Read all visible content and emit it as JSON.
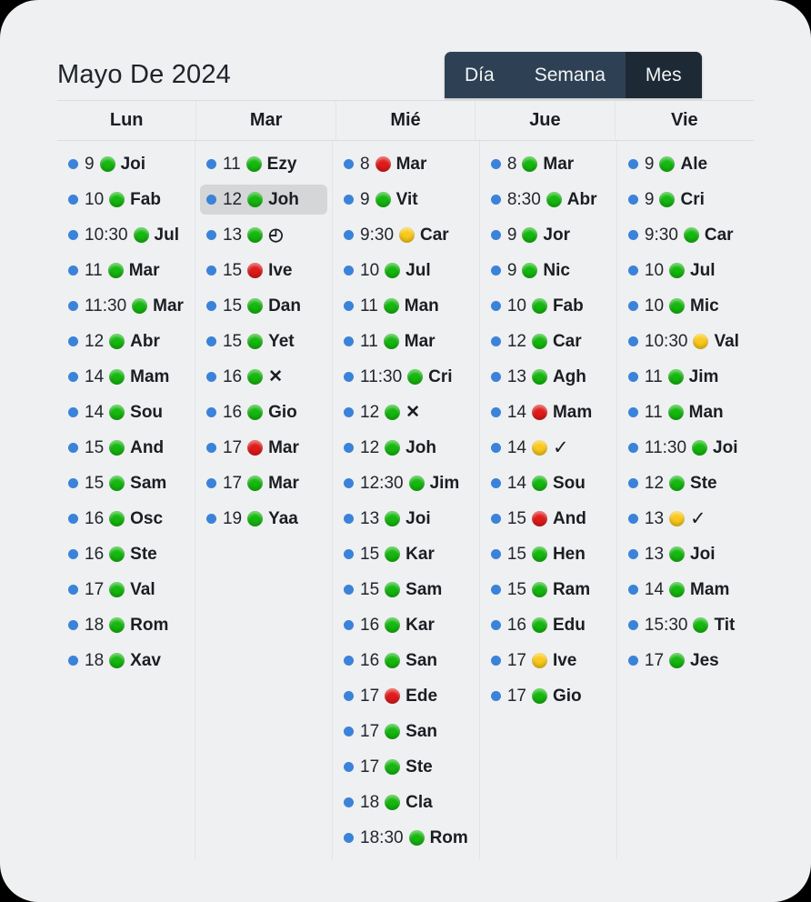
{
  "header": {
    "title": "Mayo De 2024",
    "view_switch": {
      "options": [
        {
          "label": "Día",
          "selected": false
        },
        {
          "label": "Semana",
          "selected": false
        },
        {
          "label": "Mes",
          "selected": true
        }
      ]
    }
  },
  "colors": {
    "card_background": "#eff0f2",
    "page_background": "#000000",
    "switch_bar": "#2e4154",
    "switch_active": "#1d2935",
    "bullet_blue": "#3b82d9",
    "status_green": "#15b80f",
    "status_red": "#e01b1b",
    "status_yellow": "#fbc91b",
    "selected_row": "#d5d6d8",
    "grid_line": "#e2e4e7"
  },
  "calendar": {
    "columns": [
      {
        "header": "Lun",
        "events": [
          {
            "time": "9",
            "status": "green",
            "name": "Joi",
            "selected": false
          },
          {
            "time": "10",
            "status": "green",
            "name": "Fab",
            "selected": false
          },
          {
            "time": "10:30",
            "status": "green",
            "name": "Jul",
            "selected": false
          },
          {
            "time": "11",
            "status": "green",
            "name": "Mar",
            "selected": false
          },
          {
            "time": "11:30",
            "status": "green",
            "name": "Mar",
            "selected": false
          },
          {
            "time": "12",
            "status": "green",
            "name": "Abr",
            "selected": false
          },
          {
            "time": "14",
            "status": "green",
            "name": "Mam",
            "selected": false
          },
          {
            "time": "14",
            "status": "green",
            "name": "Sou",
            "selected": false
          },
          {
            "time": "15",
            "status": "green",
            "name": "And",
            "selected": false
          },
          {
            "time": "15",
            "status": "green",
            "name": "Sam",
            "selected": false
          },
          {
            "time": "16",
            "status": "green",
            "name": "Osc",
            "selected": false
          },
          {
            "time": "16",
            "status": "green",
            "name": "Ste",
            "selected": false
          },
          {
            "time": "17",
            "status": "green",
            "name": "Val",
            "selected": false
          },
          {
            "time": "18",
            "status": "green",
            "name": "Rom",
            "selected": false
          },
          {
            "time": "18",
            "status": "green",
            "name": "Xav",
            "selected": false
          }
        ]
      },
      {
        "header": "Mar",
        "events": [
          {
            "time": "11",
            "status": "green",
            "name": "Ezy",
            "selected": false
          },
          {
            "time": "12",
            "status": "green",
            "name": "Joh",
            "selected": true
          },
          {
            "time": "13",
            "status": "green",
            "name": "◴",
            "glyph": "clock",
            "selected": false
          },
          {
            "time": "15",
            "status": "red",
            "name": "Ive",
            "selected": false
          },
          {
            "time": "15",
            "status": "green",
            "name": "Dan",
            "selected": false
          },
          {
            "time": "15",
            "status": "green",
            "name": "Yet",
            "selected": false
          },
          {
            "time": "16",
            "status": "green",
            "name": "✕",
            "glyph": "cross",
            "selected": false
          },
          {
            "time": "16",
            "status": "green",
            "name": "Gio",
            "selected": false
          },
          {
            "time": "17",
            "status": "red",
            "name": "Mar",
            "selected": false
          },
          {
            "time": "17",
            "status": "green",
            "name": "Mar",
            "selected": false
          },
          {
            "time": "19",
            "status": "green",
            "name": "Yaa",
            "selected": false
          }
        ]
      },
      {
        "header": "Mié",
        "events": [
          {
            "time": "8",
            "status": "red",
            "name": "Mar",
            "selected": false
          },
          {
            "time": "9",
            "status": "green",
            "name": "Vit",
            "selected": false
          },
          {
            "time": "9:30",
            "status": "yellow",
            "name": "Car",
            "selected": false
          },
          {
            "time": "10",
            "status": "green",
            "name": "Jul",
            "selected": false
          },
          {
            "time": "11",
            "status": "green",
            "name": "Man",
            "selected": false
          },
          {
            "time": "11",
            "status": "green",
            "name": "Mar",
            "selected": false
          },
          {
            "time": "11:30",
            "status": "green",
            "name": "Cri",
            "selected": false
          },
          {
            "time": "12",
            "status": "green",
            "name": "✕",
            "glyph": "cross",
            "selected": false
          },
          {
            "time": "12",
            "status": "green",
            "name": "Joh",
            "selected": false
          },
          {
            "time": "12:30",
            "status": "green",
            "name": "Jim",
            "selected": false
          },
          {
            "time": "13",
            "status": "green",
            "name": "Joi",
            "selected": false
          },
          {
            "time": "15",
            "status": "green",
            "name": "Kar",
            "selected": false
          },
          {
            "time": "15",
            "status": "green",
            "name": "Sam",
            "selected": false
          },
          {
            "time": "16",
            "status": "green",
            "name": "Kar",
            "selected": false
          },
          {
            "time": "16",
            "status": "green",
            "name": "San",
            "selected": false
          },
          {
            "time": "17",
            "status": "red",
            "name": "Ede",
            "selected": false
          },
          {
            "time": "17",
            "status": "green",
            "name": "San",
            "selected": false
          },
          {
            "time": "17",
            "status": "green",
            "name": "Ste",
            "selected": false
          },
          {
            "time": "18",
            "status": "green",
            "name": "Cla",
            "selected": false
          },
          {
            "time": "18:30",
            "status": "green",
            "name": "Rom",
            "selected": false
          }
        ]
      },
      {
        "header": "Jue",
        "events": [
          {
            "time": "8",
            "status": "green",
            "name": "Mar",
            "selected": false
          },
          {
            "time": "8:30",
            "status": "green",
            "name": "Abr",
            "selected": false
          },
          {
            "time": "9",
            "status": "green",
            "name": "Jor",
            "selected": false
          },
          {
            "time": "9",
            "status": "green",
            "name": "Nic",
            "selected": false
          },
          {
            "time": "10",
            "status": "green",
            "name": "Fab",
            "selected": false
          },
          {
            "time": "12",
            "status": "green",
            "name": "Car",
            "selected": false
          },
          {
            "time": "13",
            "status": "green",
            "name": "Agh",
            "selected": false
          },
          {
            "time": "14",
            "status": "red",
            "name": "Mam",
            "selected": false
          },
          {
            "time": "14",
            "status": "yellow",
            "name": "✓",
            "glyph": "check",
            "selected": false
          },
          {
            "time": "14",
            "status": "green",
            "name": "Sou",
            "selected": false
          },
          {
            "time": "15",
            "status": "red",
            "name": "And",
            "selected": false
          },
          {
            "time": "15",
            "status": "green",
            "name": "Hen",
            "selected": false
          },
          {
            "time": "15",
            "status": "green",
            "name": "Ram",
            "selected": false
          },
          {
            "time": "16",
            "status": "green",
            "name": "Edu",
            "selected": false
          },
          {
            "time": "17",
            "status": "yellow",
            "name": "Ive",
            "selected": false
          },
          {
            "time": "17",
            "status": "green",
            "name": "Gio",
            "selected": false
          }
        ]
      },
      {
        "header": "Vie",
        "events": [
          {
            "time": "9",
            "status": "green",
            "name": "Ale",
            "selected": false
          },
          {
            "time": "9",
            "status": "green",
            "name": "Cri",
            "selected": false
          },
          {
            "time": "9:30",
            "status": "green",
            "name": "Car",
            "selected": false
          },
          {
            "time": "10",
            "status": "green",
            "name": "Jul",
            "selected": false
          },
          {
            "time": "10",
            "status": "green",
            "name": "Mic",
            "selected": false
          },
          {
            "time": "10:30",
            "status": "yellow",
            "name": "Val",
            "selected": false
          },
          {
            "time": "11",
            "status": "green",
            "name": "Jim",
            "selected": false
          },
          {
            "time": "11",
            "status": "green",
            "name": "Man",
            "selected": false
          },
          {
            "time": "11:30",
            "status": "green",
            "name": "Joi",
            "selected": false
          },
          {
            "time": "12",
            "status": "green",
            "name": "Ste",
            "selected": false
          },
          {
            "time": "13",
            "status": "yellow",
            "name": "✓",
            "glyph": "check",
            "selected": false
          },
          {
            "time": "13",
            "status": "green",
            "name": "Joi",
            "selected": false
          },
          {
            "time": "14",
            "status": "green",
            "name": "Mam",
            "selected": false
          },
          {
            "time": "15:30",
            "status": "green",
            "name": "Tit",
            "selected": false
          },
          {
            "time": "17",
            "status": "green",
            "name": "Jes",
            "selected": false
          }
        ]
      }
    ]
  }
}
